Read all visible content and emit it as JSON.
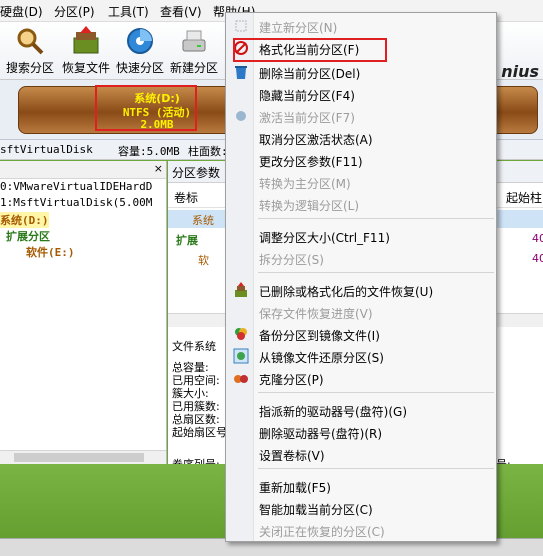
{
  "menubar": {
    "items": [
      "硬盘(D)",
      "分区(P)",
      "工具(T)",
      "查看(V)",
      "帮助(H)"
    ]
  },
  "toolbar": {
    "buttons": [
      {
        "label": "搜索分区",
        "icon": "search-partition-icon"
      },
      {
        "label": "恢复文件",
        "icon": "recover-files-icon"
      },
      {
        "label": "快速分区",
        "icon": "quick-partition-icon"
      },
      {
        "label": "新建分区",
        "icon": "new-partition-icon"
      }
    ],
    "brand_text": "nius"
  },
  "disk": {
    "partition_name": "系统(D:)",
    "filesystem": "NTFS (活动)",
    "size": "2.0MB",
    "bar_color": "#8a4b17",
    "label_color": "#fff200"
  },
  "infostrip": {
    "disk_name": "sftVirtualDisk",
    "capacity": "容量:5.0MB",
    "cylinders": "柱面数:1024"
  },
  "tree": {
    "rows": [
      "0:VMwareVirtualIDEHardD",
      "1:MsftVirtualDisk(5.00M",
      "系统(D:)",
      "扩展分区",
      "软件(E:)"
    ]
  },
  "rightpane": {
    "tab_label": "分区参数",
    "col_label": "卷标",
    "col_start_cyl": "起始柱",
    "rows": [
      {
        "label": "系统",
        "value": ""
      },
      {
        "label": "扩展",
        "value": "40"
      },
      {
        "label": "软",
        "value": "40"
      }
    ],
    "fs_label": "文件系统",
    "fields": [
      "总容量:",
      "已用空间:",
      "簇大小:",
      "已用簇数:",
      "总扇区数:",
      "起始扇区号:"
    ],
    "serial_label": "卷序列号:",
    "serial_right": "号:"
  },
  "context_menu": {
    "items": [
      {
        "label": "建立新分区(N)",
        "disabled": true,
        "icon": "new-partition-icon"
      },
      {
        "label": "格式化当前分区(F)",
        "disabled": false,
        "icon": "format-icon"
      },
      {
        "label": "删除当前分区(Del)",
        "disabled": false,
        "icon": "delete-bin-icon"
      },
      {
        "label": "隐藏当前分区(F4)",
        "disabled": false,
        "icon": ""
      },
      {
        "label": "激活当前分区(F7)",
        "disabled": true,
        "icon": "activate-icon"
      },
      {
        "label": "取消分区激活状态(A)",
        "disabled": false,
        "icon": ""
      },
      {
        "label": "更改分区参数(F11)",
        "disabled": false,
        "icon": ""
      },
      {
        "label": "转换为主分区(M)",
        "disabled": true,
        "icon": ""
      },
      {
        "label": "转换为逻辑分区(L)",
        "disabled": true,
        "icon": ""
      },
      {
        "label": "调整分区大小(Ctrl_F11)",
        "disabled": false,
        "icon": ""
      },
      {
        "label": "拆分分区(S)",
        "disabled": true,
        "icon": ""
      },
      {
        "label": "已删除或格式化后的文件恢复(U)",
        "disabled": false,
        "icon": "file-recover-icon"
      },
      {
        "label": "保存文件恢复进度(V)",
        "disabled": true,
        "icon": ""
      },
      {
        "label": "备份分区到镜像文件(I)",
        "disabled": false,
        "icon": "backup-image-icon"
      },
      {
        "label": "从镜像文件还原分区(S)",
        "disabled": false,
        "icon": "restore-image-icon"
      },
      {
        "label": "克隆分区(P)",
        "disabled": false,
        "icon": "clone-icon"
      },
      {
        "label": "指派新的驱动器号(盘符)(G)",
        "disabled": false,
        "icon": ""
      },
      {
        "label": "删除驱动器号(盘符)(R)",
        "disabled": false,
        "icon": ""
      },
      {
        "label": "设置卷标(V)",
        "disabled": false,
        "icon": ""
      },
      {
        "label": "重新加载(F5)",
        "disabled": false,
        "icon": ""
      },
      {
        "label": "智能加载当前分区(C)",
        "disabled": false,
        "icon": ""
      },
      {
        "label": "关闭正在恢复的分区(C)",
        "disabled": true,
        "icon": ""
      }
    ],
    "highlight_color": "#e02020"
  }
}
